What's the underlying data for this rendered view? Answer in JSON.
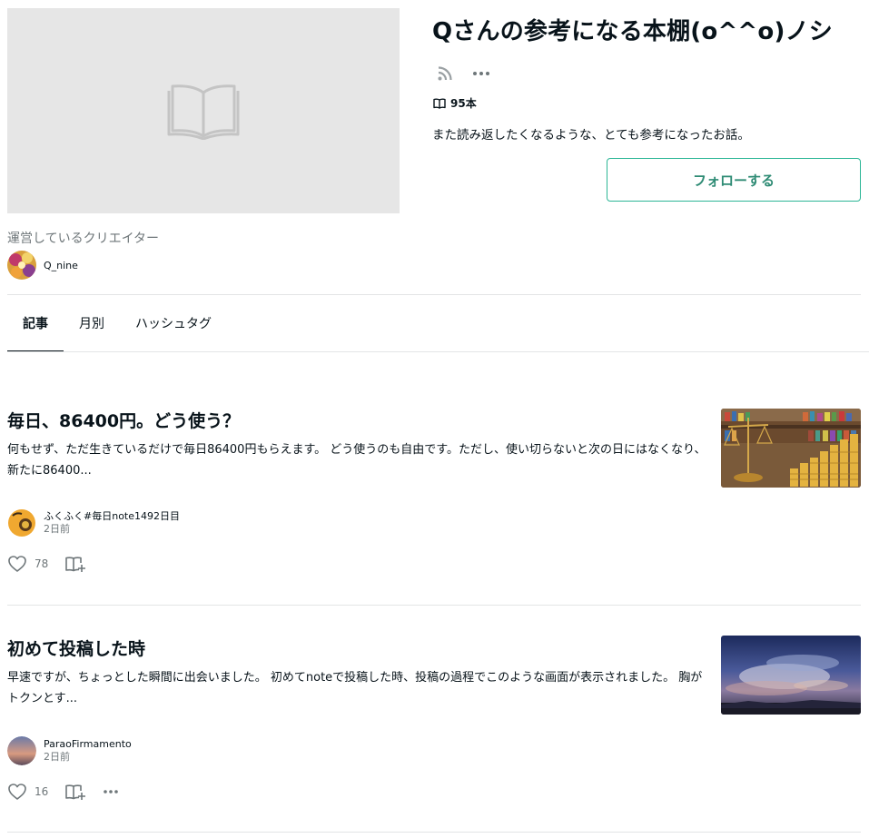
{
  "magazine": {
    "title": "Qさんの参考になる本棚(o^^o)ノシ",
    "count": "95本",
    "description": "また読み返したくなるような、とても参考になったお話。",
    "follow_label": "フォローする"
  },
  "creator": {
    "label": "運営しているクリエイター",
    "name": "Q_nine"
  },
  "tabs": [
    {
      "label": "記事",
      "active": true
    },
    {
      "label": "月別",
      "active": false
    },
    {
      "label": "ハッシュタグ",
      "active": false
    }
  ],
  "articles": [
    {
      "title": "毎日、86400円。どう使う？",
      "excerpt": "何もせず、ただ生きているだけで毎日86400円もらえます。 どう使うのも自由です。ただし、使い切らないと次の日にはなくなり、新たに86400...",
      "author": "ふくふく#毎日note1492日目",
      "time": "2日前",
      "likes": "78"
    },
    {
      "title": "初めて投稿した時",
      "excerpt": "早速ですが、ちょっとした瞬間に出会いました。 初めてnoteで投稿した時、投稿の過程でこのような画面が表示されました。 胸がトクンとす...",
      "author": "ParaoFirmamento",
      "time": "2日前",
      "likes": "16"
    }
  ],
  "colors": {
    "accent": "#2cb696",
    "text": "#08131a",
    "muted": "#6e7679",
    "border": "#e3e5e6",
    "cover_bg": "#e6e6e6"
  }
}
